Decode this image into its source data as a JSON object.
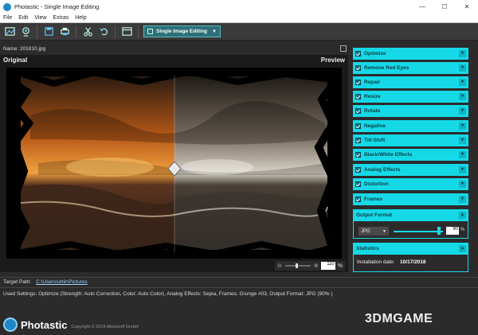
{
  "window": {
    "title": "Photastic - Single Image Editing",
    "minimize": "—",
    "maximize": "☐",
    "close": "✕"
  },
  "menu": [
    "File",
    "Edit",
    "View",
    "Extras",
    "Help"
  ],
  "toolbar": {
    "icons": [
      "open-image-icon",
      "webcam-icon",
      "save-icon",
      "print-icon",
      "cut-icon",
      "undo-icon",
      "window-icon"
    ],
    "mode": "Single Image Editing"
  },
  "image": {
    "name_label": "Name: 201810.jpg",
    "original_label": "Original",
    "preview_label": "Preview",
    "zoom": "110",
    "zoom_unit": "%"
  },
  "sidebar": {
    "items": [
      {
        "label": "Optimize"
      },
      {
        "label": "Remove Red Eyes"
      },
      {
        "label": "Repair"
      },
      {
        "label": "Resize"
      },
      {
        "label": "Rotate"
      },
      {
        "label": "Negative"
      },
      {
        "label": "Tilt-Shift"
      },
      {
        "label": "Black/White Effects"
      },
      {
        "label": "Analog Effects"
      },
      {
        "label": "Distortion"
      },
      {
        "label": "Frames"
      }
    ],
    "output_format": {
      "title": "Output Format",
      "format": "JPG",
      "quality": "90",
      "unit": "%",
      "quality_fraction": 0.9
    },
    "statistics": {
      "title": "Statistics",
      "installation_label": "Installation date:",
      "installation_date": "10/17/2018"
    }
  },
  "target": {
    "label": "Target Path:",
    "path": "C:\\Users\\uhlir\\Pictures"
  },
  "used_settings": "Used Settings: Optimize (Strength: Auto Correction, Color: Auto Color), Analog Effects: Sepia, Frames: Grunge #03, Output Format: JPG (90% )",
  "footer": {
    "brand": "Photastic",
    "copyright": "Copyright © 2018 Abelssoft GmbH"
  },
  "watermark": "3DMGAME",
  "colors": {
    "accent": "#16d9e8",
    "background": "#2b2b2b",
    "toolbar": "#3a3a3a"
  }
}
